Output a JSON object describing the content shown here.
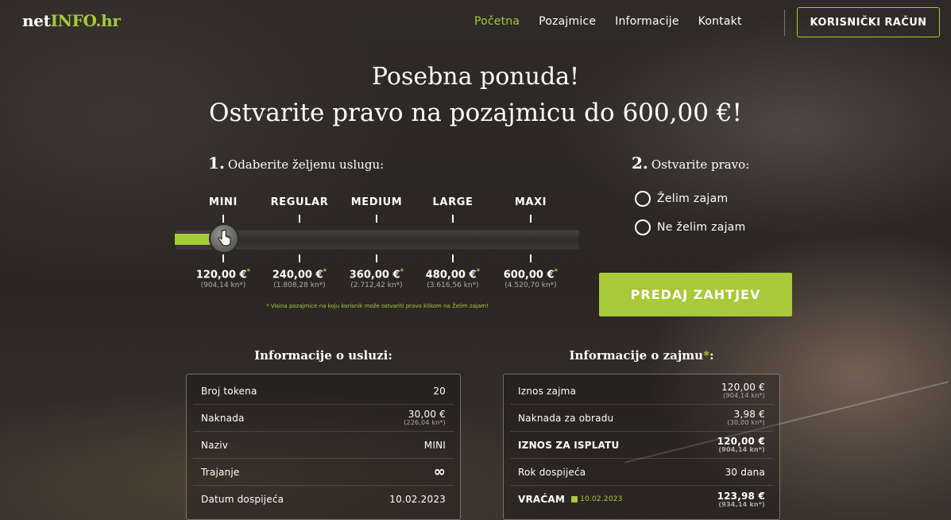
{
  "nav": {
    "logo_part1": "net",
    "logo_part2": "INFO.hr",
    "items": [
      "Početna",
      "Pozajmice",
      "Informacije",
      "Kontakt"
    ],
    "account_button": "KORISNIČKI RAČUN"
  },
  "hero": {
    "line1": "Posebna ponuda!",
    "line2": "Ostvarite pravo na pozajmicu do 600,00 €!"
  },
  "step1": {
    "number": "1.",
    "label": "Odaberite željenu uslugu:"
  },
  "step2": {
    "number": "2.",
    "label": "Ostvarite pravo:"
  },
  "slider": {
    "selected_index": 0,
    "tiers": [
      {
        "name": "MINI",
        "price": "120,00 €",
        "kn": "(904,14 kn*)"
      },
      {
        "name": "REGULAR",
        "price": "240,00 €",
        "kn": "(1.808,28 kn*)"
      },
      {
        "name": "MEDIUM",
        "price": "360,00 €",
        "kn": "(2.712,42 kn*)"
      },
      {
        "name": "LARGE",
        "price": "480,00 €",
        "kn": "(3.616,56 kn*)"
      },
      {
        "name": "MAXI",
        "price": "600,00 €",
        "kn": "(4.520,70 kn*)"
      }
    ],
    "star": "*",
    "note": "* Visina pozajmice na koju korisnik može ostvariti pravo klikom na Želim zajam!"
  },
  "radios": {
    "option1": "Želim zajam",
    "option2": "Ne želim zajam"
  },
  "submit_button": "PREDAJ ZAHTJEV",
  "service_info": {
    "title": "Informacije o usluzi:",
    "rows": [
      {
        "label": "Broj tokena",
        "value": "20"
      },
      {
        "label": "Naknada",
        "value": "30,00 €",
        "sub": "(226,04 kn*)"
      },
      {
        "label": "Naziv",
        "value": "MINI"
      },
      {
        "label": "Trajanje",
        "value": "∞"
      },
      {
        "label": "Datum dospijeća",
        "value": "10.02.2023"
      }
    ]
  },
  "loan_info": {
    "title": "Informacije o zajmu",
    "title_star": "*",
    "title_suffix": ":",
    "rows": [
      {
        "label": "Iznos zajma",
        "value": "120,00 €",
        "sub": "(904,14 kn*)"
      },
      {
        "label": "Naknada za obradu",
        "value": "3,98 €",
        "sub": "(30,00 kn*)"
      },
      {
        "label": "IZNOS ZA ISPLATU",
        "value": "120,00 €",
        "sub": "(904,14 kn*)"
      },
      {
        "label": "Rok dospijeća",
        "value": "30 dana"
      },
      {
        "label": "VRAĆAM",
        "date": "10.02.2023",
        "value": "123,98 €",
        "sub": "(934,14 kn*)"
      }
    ]
  },
  "colors": {
    "accent": "#a8c93a"
  }
}
